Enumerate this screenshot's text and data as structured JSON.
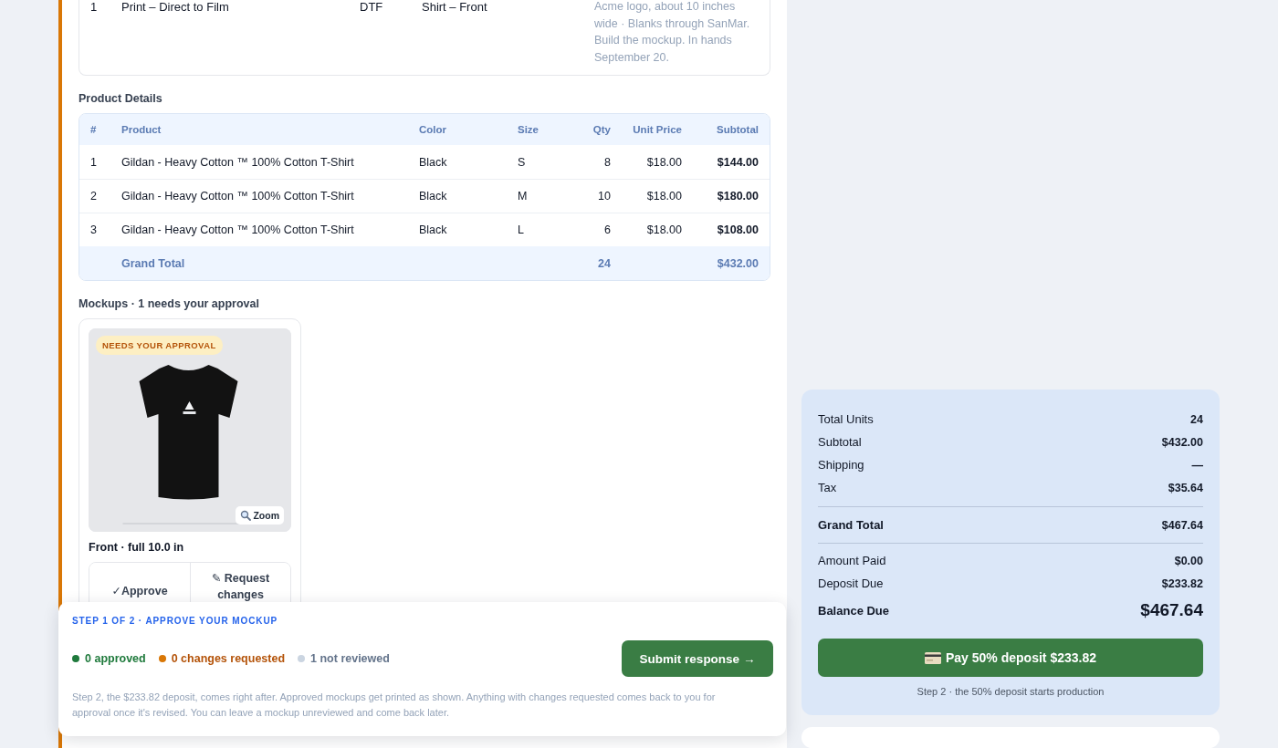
{
  "print_items": {
    "rows": [
      {
        "column_1": "1",
        "column_2": "Print – Direct to Film",
        "column_3": "DTF",
        "column_4": "Shirt – Front",
        "column_5": "Acme logo, about 10 inches wide · Blanks through SanMar. Build the mockup. In hands September 20."
      }
    ]
  },
  "product_details": {
    "title": "Product Details",
    "columns": [
      "#",
      "Product",
      "Color",
      "Size",
      "Qty",
      "Unit Price",
      "Subtotal"
    ],
    "rows": [
      {
        "cells": [
          "1",
          "Gildan - Heavy Cotton ™ 100% Cotton T-Shirt",
          "Black",
          "S",
          "8",
          "$18.00",
          "$144.00"
        ]
      },
      {
        "cells": [
          "2",
          "Gildan - Heavy Cotton ™ 100% Cotton T-Shirt",
          "Black",
          "M",
          "10",
          "$18.00",
          "$180.00"
        ]
      },
      {
        "cells": [
          "3",
          "Gildan - Heavy Cotton ™ 100% Cotton T-Shirt",
          "Black",
          "L",
          "6",
          "$18.00",
          "$108.00"
        ]
      }
    ],
    "total_row": {
      "label": "Grand Total",
      "qty": "24",
      "subtotal": "$432.00"
    }
  },
  "mockups": {
    "title": "Mockups · 1 needs your approval",
    "items": [
      {
        "badge": "NEEDS YOUR APPROVAL",
        "zoom": "Zoom",
        "caption": "Front · full 10.0 in",
        "approve": "✓Approve",
        "request": "✎ Request changes"
      }
    ]
  },
  "summary": {
    "rows": [
      {
        "kind": "plain",
        "label": "Total Units",
        "value": "24"
      },
      {
        "kind": "plain",
        "label": "Subtotal",
        "value": "$432.00"
      },
      {
        "kind": "plain",
        "label": "Shipping",
        "value": "—"
      },
      {
        "kind": "plain",
        "label": "Tax",
        "value": "$35.64"
      },
      {
        "kind": "total",
        "label": "Grand Total",
        "value": "$467.64"
      },
      {
        "kind": "plain",
        "label": "Amount Paid",
        "value": "$0.00"
      },
      {
        "kind": "plain",
        "label": "Deposit Due",
        "value": "$233.82"
      },
      {
        "kind": "balance",
        "label": "Balance Due",
        "value": "$467.64"
      }
    ],
    "pay_button": "Pay 50% deposit $233.82",
    "note": "Step 2 · the 50% deposit starts production"
  },
  "step_panel": {
    "step": "STEP 1 OF 2 · APPROVE YOUR MOCKUP",
    "legend": [
      {
        "kind": "approved",
        "label": "0 approved",
        "color": "#1f7a3c"
      },
      {
        "kind": "changes",
        "label": "0 changes requested",
        "color": "#d97706"
      },
      {
        "kind": "pending",
        "label": "1 not reviewed",
        "color": "#cbd5e1"
      }
    ],
    "submit": "Submit response →",
    "note": "Step 2, the $233.82 deposit, comes right after. Approved mockups get printed as shown. Anything with changes requested comes back to you for approval once it's revised. You can leave a mockup unreviewed and come back later."
  }
}
